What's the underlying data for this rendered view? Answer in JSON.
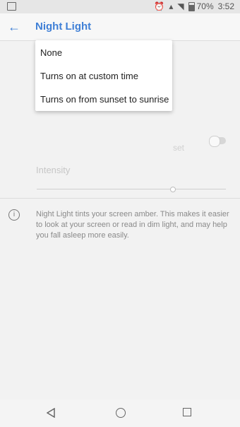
{
  "statusbar": {
    "battery_text": "70%",
    "time": "3:52"
  },
  "appbar": {
    "title": "Night Light"
  },
  "settings": {
    "partial_label": "set",
    "intensity_label": "Intensity",
    "intensity_value": 0.72
  },
  "info": {
    "text": "Night Light tints your screen amber. This makes it easier to look at your screen or read in dim light, and may help you fall asleep more easily."
  },
  "dropdown": {
    "options": [
      "None",
      "Turns on at custom time",
      "Turns on from sunset to sunrise"
    ]
  },
  "icons": {
    "status_image": "image-icon",
    "alarm": "alarm-icon",
    "wifi": "wifi-icon",
    "signal": "signal-icon",
    "battery": "battery-icon",
    "back": "arrow-left-icon",
    "info": "info-icon",
    "nav_back": "nav-back-icon",
    "nav_home": "nav-home-icon",
    "nav_recent": "nav-recent-icon"
  },
  "colors": {
    "accent": "#3f7fd6"
  }
}
